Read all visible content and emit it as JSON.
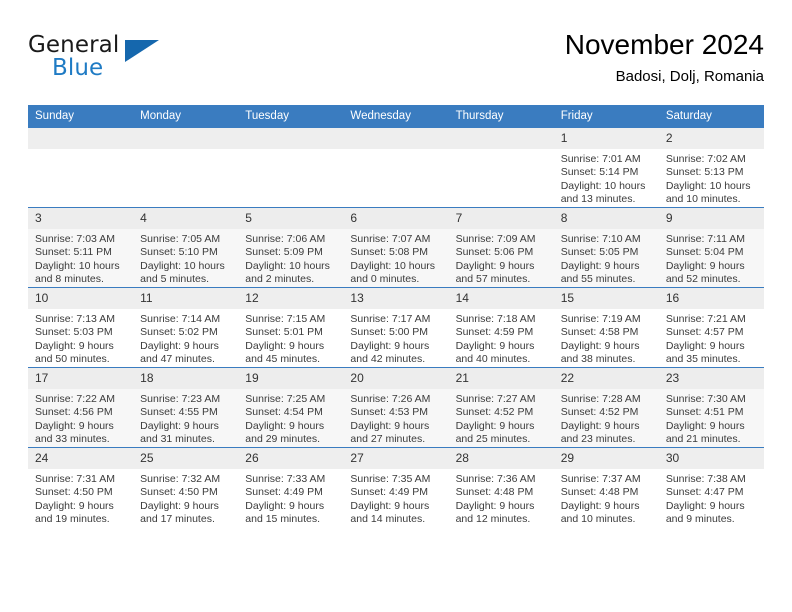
{
  "brand": {
    "name_part1": "General",
    "name_part2": "Blue",
    "accent_color": "#1f7bc4",
    "triangle_color": "#1567ad",
    "triangle_icon": "triangle-icon"
  },
  "header": {
    "title": "November 2024",
    "subtitle": "Badosi, Dolj, Romania"
  },
  "calendar": {
    "header_bg": "#3a7cc0",
    "weekday_headers": [
      "Sunday",
      "Monday",
      "Tuesday",
      "Wednesday",
      "Thursday",
      "Friday",
      "Saturday"
    ],
    "weeks": [
      [
        {
          "day": "",
          "sunrise": "",
          "sunset": "",
          "daylight1": "",
          "daylight2": ""
        },
        {
          "day": "",
          "sunrise": "",
          "sunset": "",
          "daylight1": "",
          "daylight2": ""
        },
        {
          "day": "",
          "sunrise": "",
          "sunset": "",
          "daylight1": "",
          "daylight2": ""
        },
        {
          "day": "",
          "sunrise": "",
          "sunset": "",
          "daylight1": "",
          "daylight2": ""
        },
        {
          "day": "",
          "sunrise": "",
          "sunset": "",
          "daylight1": "",
          "daylight2": ""
        },
        {
          "day": "1",
          "sunrise": "Sunrise: 7:01 AM",
          "sunset": "Sunset: 5:14 PM",
          "daylight1": "Daylight: 10 hours",
          "daylight2": "and 13 minutes."
        },
        {
          "day": "2",
          "sunrise": "Sunrise: 7:02 AM",
          "sunset": "Sunset: 5:13 PM",
          "daylight1": "Daylight: 10 hours",
          "daylight2": "and 10 minutes."
        }
      ],
      [
        {
          "day": "3",
          "sunrise": "Sunrise: 7:03 AM",
          "sunset": "Sunset: 5:11 PM",
          "daylight1": "Daylight: 10 hours",
          "daylight2": "and 8 minutes."
        },
        {
          "day": "4",
          "sunrise": "Sunrise: 7:05 AM",
          "sunset": "Sunset: 5:10 PM",
          "daylight1": "Daylight: 10 hours",
          "daylight2": "and 5 minutes."
        },
        {
          "day": "5",
          "sunrise": "Sunrise: 7:06 AM",
          "sunset": "Sunset: 5:09 PM",
          "daylight1": "Daylight: 10 hours",
          "daylight2": "and 2 minutes."
        },
        {
          "day": "6",
          "sunrise": "Sunrise: 7:07 AM",
          "sunset": "Sunset: 5:08 PM",
          "daylight1": "Daylight: 10 hours",
          "daylight2": "and 0 minutes."
        },
        {
          "day": "7",
          "sunrise": "Sunrise: 7:09 AM",
          "sunset": "Sunset: 5:06 PM",
          "daylight1": "Daylight: 9 hours",
          "daylight2": "and 57 minutes."
        },
        {
          "day": "8",
          "sunrise": "Sunrise: 7:10 AM",
          "sunset": "Sunset: 5:05 PM",
          "daylight1": "Daylight: 9 hours",
          "daylight2": "and 55 minutes."
        },
        {
          "day": "9",
          "sunrise": "Sunrise: 7:11 AM",
          "sunset": "Sunset: 5:04 PM",
          "daylight1": "Daylight: 9 hours",
          "daylight2": "and 52 minutes."
        }
      ],
      [
        {
          "day": "10",
          "sunrise": "Sunrise: 7:13 AM",
          "sunset": "Sunset: 5:03 PM",
          "daylight1": "Daylight: 9 hours",
          "daylight2": "and 50 minutes."
        },
        {
          "day": "11",
          "sunrise": "Sunrise: 7:14 AM",
          "sunset": "Sunset: 5:02 PM",
          "daylight1": "Daylight: 9 hours",
          "daylight2": "and 47 minutes."
        },
        {
          "day": "12",
          "sunrise": "Sunrise: 7:15 AM",
          "sunset": "Sunset: 5:01 PM",
          "daylight1": "Daylight: 9 hours",
          "daylight2": "and 45 minutes."
        },
        {
          "day": "13",
          "sunrise": "Sunrise: 7:17 AM",
          "sunset": "Sunset: 5:00 PM",
          "daylight1": "Daylight: 9 hours",
          "daylight2": "and 42 minutes."
        },
        {
          "day": "14",
          "sunrise": "Sunrise: 7:18 AM",
          "sunset": "Sunset: 4:59 PM",
          "daylight1": "Daylight: 9 hours",
          "daylight2": "and 40 minutes."
        },
        {
          "day": "15",
          "sunrise": "Sunrise: 7:19 AM",
          "sunset": "Sunset: 4:58 PM",
          "daylight1": "Daylight: 9 hours",
          "daylight2": "and 38 minutes."
        },
        {
          "day": "16",
          "sunrise": "Sunrise: 7:21 AM",
          "sunset": "Sunset: 4:57 PM",
          "daylight1": "Daylight: 9 hours",
          "daylight2": "and 35 minutes."
        }
      ],
      [
        {
          "day": "17",
          "sunrise": "Sunrise: 7:22 AM",
          "sunset": "Sunset: 4:56 PM",
          "daylight1": "Daylight: 9 hours",
          "daylight2": "and 33 minutes."
        },
        {
          "day": "18",
          "sunrise": "Sunrise: 7:23 AM",
          "sunset": "Sunset: 4:55 PM",
          "daylight1": "Daylight: 9 hours",
          "daylight2": "and 31 minutes."
        },
        {
          "day": "19",
          "sunrise": "Sunrise: 7:25 AM",
          "sunset": "Sunset: 4:54 PM",
          "daylight1": "Daylight: 9 hours",
          "daylight2": "and 29 minutes."
        },
        {
          "day": "20",
          "sunrise": "Sunrise: 7:26 AM",
          "sunset": "Sunset: 4:53 PM",
          "daylight1": "Daylight: 9 hours",
          "daylight2": "and 27 minutes."
        },
        {
          "day": "21",
          "sunrise": "Sunrise: 7:27 AM",
          "sunset": "Sunset: 4:52 PM",
          "daylight1": "Daylight: 9 hours",
          "daylight2": "and 25 minutes."
        },
        {
          "day": "22",
          "sunrise": "Sunrise: 7:28 AM",
          "sunset": "Sunset: 4:52 PM",
          "daylight1": "Daylight: 9 hours",
          "daylight2": "and 23 minutes."
        },
        {
          "day": "23",
          "sunrise": "Sunrise: 7:30 AM",
          "sunset": "Sunset: 4:51 PM",
          "daylight1": "Daylight: 9 hours",
          "daylight2": "and 21 minutes."
        }
      ],
      [
        {
          "day": "24",
          "sunrise": "Sunrise: 7:31 AM",
          "sunset": "Sunset: 4:50 PM",
          "daylight1": "Daylight: 9 hours",
          "daylight2": "and 19 minutes."
        },
        {
          "day": "25",
          "sunrise": "Sunrise: 7:32 AM",
          "sunset": "Sunset: 4:50 PM",
          "daylight1": "Daylight: 9 hours",
          "daylight2": "and 17 minutes."
        },
        {
          "day": "26",
          "sunrise": "Sunrise: 7:33 AM",
          "sunset": "Sunset: 4:49 PM",
          "daylight1": "Daylight: 9 hours",
          "daylight2": "and 15 minutes."
        },
        {
          "day": "27",
          "sunrise": "Sunrise: 7:35 AM",
          "sunset": "Sunset: 4:49 PM",
          "daylight1": "Daylight: 9 hours",
          "daylight2": "and 14 minutes."
        },
        {
          "day": "28",
          "sunrise": "Sunrise: 7:36 AM",
          "sunset": "Sunset: 4:48 PM",
          "daylight1": "Daylight: 9 hours",
          "daylight2": "and 12 minutes."
        },
        {
          "day": "29",
          "sunrise": "Sunrise: 7:37 AM",
          "sunset": "Sunset: 4:48 PM",
          "daylight1": "Daylight: 9 hours",
          "daylight2": "and 10 minutes."
        },
        {
          "day": "30",
          "sunrise": "Sunrise: 7:38 AM",
          "sunset": "Sunset: 4:47 PM",
          "daylight1": "Daylight: 9 hours",
          "daylight2": "and 9 minutes."
        }
      ]
    ]
  }
}
